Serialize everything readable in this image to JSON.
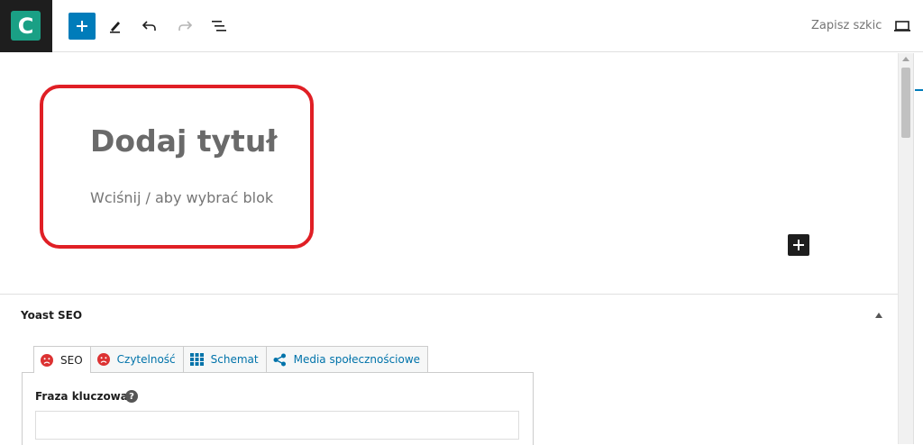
{
  "toolbar": {
    "logo_letter": "C",
    "logo_color": "#1aa085",
    "accent_color": "#007cba",
    "add_icon": "plus-icon",
    "edit_icon": "pencil-icon",
    "undo_icon": "undo-icon",
    "redo_icon": "redo-icon",
    "outline_icon": "list-view-icon",
    "save_draft_label": "Zapisz szkic",
    "preview_icon": "desktop-preview-icon"
  },
  "editor": {
    "title_placeholder": "Dodaj tytuł",
    "block_placeholder": "Wciśnij / aby wybrać blok",
    "highlight_color": "#e01f25"
  },
  "yoast": {
    "title": "Yoast SEO",
    "tabs": [
      {
        "label": "SEO",
        "icon": "sad-face-icon",
        "icon_color": "#dc3232",
        "active": true
      },
      {
        "label": "Czytelność",
        "icon": "sad-face-icon",
        "icon_color": "#dc3232",
        "active": false
      },
      {
        "label": "Schemat",
        "icon": "grid-icon",
        "active": false
      },
      {
        "label": "Media społecznościowe",
        "icon": "share-icon",
        "active": false
      }
    ],
    "keyphrase_label": "Fraza kluczowa",
    "help_symbol": "?",
    "keyphrase_value": ""
  }
}
